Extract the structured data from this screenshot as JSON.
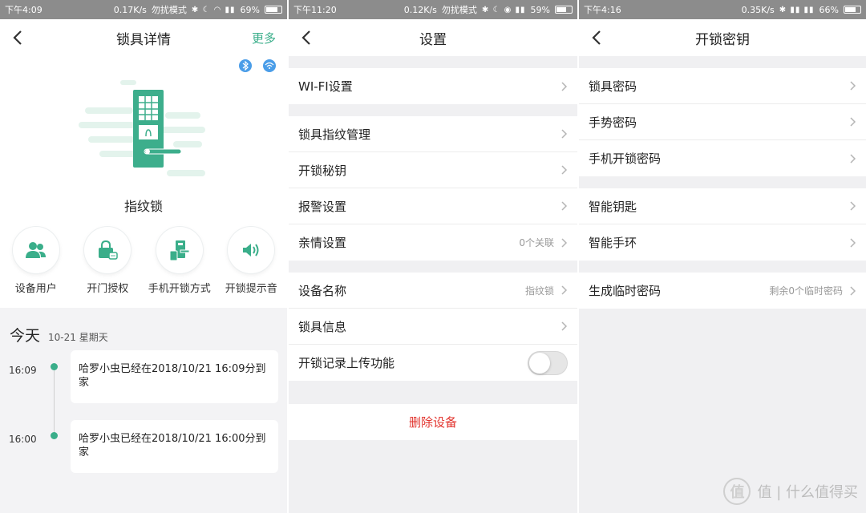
{
  "colors": {
    "accent": "#3aae8a",
    "danger": "#e2342e",
    "statusbar": "#8c8c8c",
    "bluetooth": "#4a9de8"
  },
  "panel1": {
    "status": {
      "time": "下午4:09",
      "speed": "0.17K/s",
      "mode": "勿扰模式",
      "battery": "69%",
      "battery_level": 0.69
    },
    "title": "锁具详情",
    "more": "更多",
    "device_name": "指纹锁",
    "features": [
      {
        "label": "设备用户",
        "icon": "users-icon"
      },
      {
        "label": "开门授权",
        "icon": "lock-message-icon"
      },
      {
        "label": "手机开锁方式",
        "icon": "phone-lock-icon"
      },
      {
        "label": "开锁提示音",
        "icon": "speaker-icon"
      }
    ],
    "today_label": "今天",
    "today_date": "10-21 星期天",
    "events": [
      {
        "time": "16:09",
        "text": "哈罗小虫已经在2018/10/21 16:09分到家"
      },
      {
        "time": "16:00",
        "text": "哈罗小虫已经在2018/10/21 16:00分到家"
      }
    ]
  },
  "panel2": {
    "status": {
      "time": "下午11:20",
      "speed": "0.12K/s",
      "mode": "勿扰模式",
      "battery": "59%",
      "battery_level": 0.59
    },
    "title": "设置",
    "rows": {
      "wifi": "WI-FI设置",
      "fingerprint": "锁具指纹管理",
      "unlock_key": "开锁秘钥",
      "alarm": "报警设置",
      "family": "亲情设置",
      "family_value": "0个关联",
      "device_name": "设备名称",
      "device_name_value": "指纹锁",
      "lock_info": "锁具信息",
      "upload": "开锁记录上传功能",
      "upload_on": false
    },
    "delete": "删除设备"
  },
  "panel3": {
    "status": {
      "time": "下午4:16",
      "speed": "0.35K/s",
      "battery": "66%",
      "battery_level": 0.66
    },
    "title": "开锁密钥",
    "rows": {
      "lock_pwd": "锁具密码",
      "gesture_pwd": "手势密码",
      "phone_pwd": "手机开锁密码",
      "smart_key": "智能钥匙",
      "smart_band": "智能手环",
      "temp_pwd": "生成临时密码",
      "temp_pwd_value": "剩余0个临时密码"
    }
  },
  "watermark": "值 | 什么值得买"
}
